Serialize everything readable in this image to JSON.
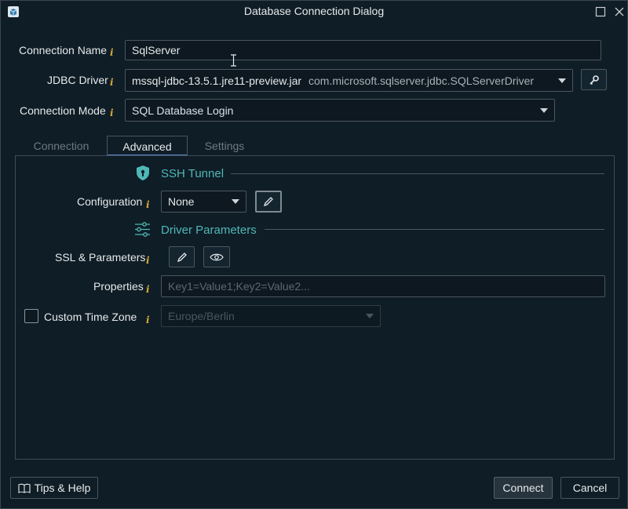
{
  "window": {
    "title": "Database Connection Dialog"
  },
  "form": {
    "connection_name_label": "Connection Name",
    "connection_name_value": "SqlServer",
    "jdbc_driver_label": "JDBC Driver",
    "jdbc_driver_jar": "mssql-jdbc-13.5.1.jre11-preview.jar",
    "jdbc_driver_class": "com.microsoft.sqlserver.jdbc.SQLServerDriver",
    "connection_mode_label": "Connection Mode",
    "connection_mode_value": "SQL Database Login",
    "info_glyph": "i"
  },
  "tabs": [
    {
      "label": "Connection",
      "active": false
    },
    {
      "label": "Advanced",
      "active": true
    },
    {
      "label": "Settings",
      "active": false
    }
  ],
  "advanced": {
    "ssh_tunnel_title": "SSH Tunnel",
    "configuration_label": "Configuration",
    "configuration_value": "None",
    "driver_params_title": "Driver Parameters",
    "ssl_params_label": "SSL & Parameters",
    "properties_label": "Properties",
    "properties_placeholder": "Key1=Value1;Key2=Value2...",
    "custom_tz_label": "Custom Time Zone",
    "custom_tz_checked": false,
    "custom_tz_value": "Europe/Berlin"
  },
  "footer": {
    "tips_label": "Tips & Help",
    "connect_label": "Connect",
    "cancel_label": "Cancel"
  },
  "colors": {
    "background": "#0f1d26",
    "accent_teal": "#4fb8b7",
    "info_gold": "#d4a93a",
    "active_tab_underline": "#5f86c8"
  },
  "icons": [
    "app-icon",
    "maximize-icon",
    "close-icon",
    "key-icon",
    "shield-icon",
    "pencil-icon",
    "sliders-icon",
    "eye-icon",
    "book-icon",
    "text-cursor-icon"
  ]
}
